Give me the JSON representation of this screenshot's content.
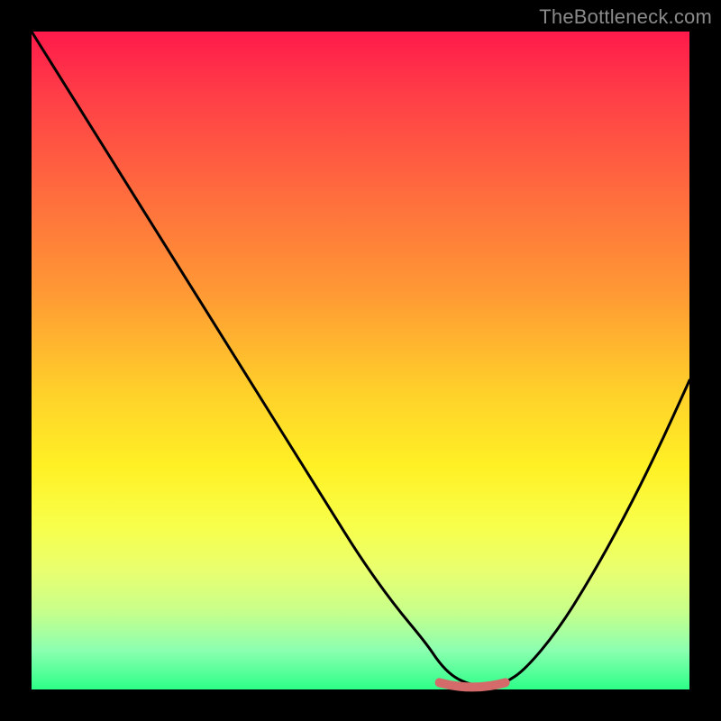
{
  "watermark": "TheBottleneck.com",
  "colors": {
    "frame": "#000000",
    "curve": "#000000",
    "marker_segment": "#d46a6a",
    "gradient_top": "#ff1a4b",
    "gradient_mid": "#fff025",
    "gradient_bottom": "#2cff88"
  },
  "chart_data": {
    "type": "line",
    "title": "",
    "xlabel": "",
    "ylabel": "",
    "xlim": [
      0,
      100
    ],
    "ylim": [
      0,
      100
    ],
    "x": [
      0,
      5,
      10,
      15,
      20,
      25,
      30,
      35,
      40,
      45,
      50,
      55,
      60,
      62,
      64,
      66,
      68,
      70,
      72,
      75,
      80,
      85,
      90,
      95,
      100
    ],
    "values": [
      100,
      92,
      84,
      76,
      68,
      60,
      52,
      44,
      36,
      28,
      20,
      13,
      7,
      4,
      2,
      1,
      0.5,
      0.5,
      1,
      3,
      9,
      17,
      26,
      36,
      47
    ],
    "optimal_range_x": [
      62,
      72
    ],
    "optimal_range_y": 0.5,
    "note": "x in percent of plot width, values in percent of plot height from bottom; gradient encodes red=high bottleneck at top to green=low at bottom; salmon segment marks optimal zone near minimum"
  }
}
